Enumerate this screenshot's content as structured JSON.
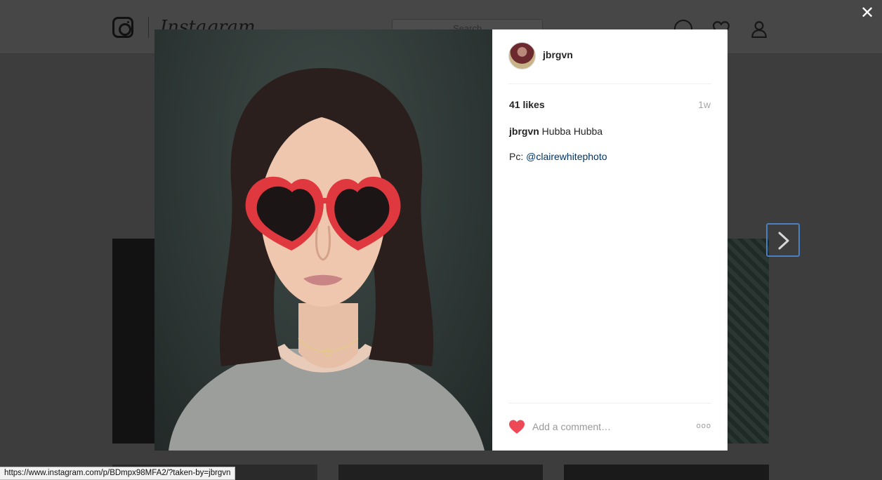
{
  "background": {
    "brand_name": "Instagram",
    "search_placeholder": "Search"
  },
  "overlay": {
    "close_label": "✕"
  },
  "post": {
    "username": "jbrgvn",
    "likes": "41 likes",
    "timestamp": "1w",
    "caption_user": "jbrgvn",
    "caption_text": "Hubba Hubba",
    "credit_prefix": "Pc: ",
    "credit_mention": "@clairewhitephoto",
    "comment_placeholder": "Add a comment…",
    "more_label": "ooo"
  },
  "status_bar": {
    "url": "https://www.instagram.com/p/BDmpx98MFA2/?taken-by=jbrgvn"
  },
  "colors": {
    "overlay_dim": "#3d3d3d",
    "like_heart": "#ed4956",
    "link": "#003569",
    "next_focus": "#4a7fc1",
    "sunglasses": "#e0383f"
  }
}
